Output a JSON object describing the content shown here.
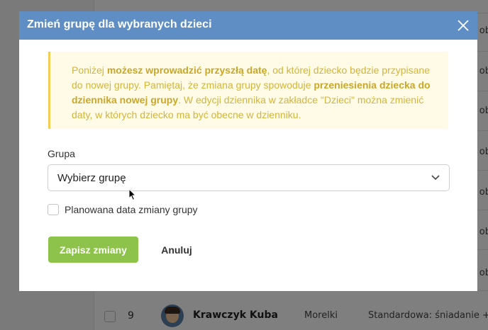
{
  "modal": {
    "title": "Zmień grupę dla wybranych dzieci",
    "notice": {
      "p1": "Poniżej ",
      "b1": "możesz wprowadzić przyszłą datę",
      "p2": ", od której dziecko będzie przypisane do nowej grupy. Pamiętaj, że zmiana grupy spowoduje ",
      "b2": "przeniesienia dziecka do dziennika nowej grupy",
      "p3": ". W edycji dziennika w zakładce \"Dzieci\" można zmienić daty, w których dziecko ma być obecne w dzienniku."
    },
    "group_label": "Grupa",
    "group_select_value": "Wybierz grupę",
    "planned_change_label": "Planowana data zmiany grupy",
    "save_label": "Zapisz zmiany",
    "cancel_label": "Anuluj"
  },
  "background": {
    "ob_texts": [
      "ob",
      "ob",
      "ob",
      "ob",
      "ob",
      "ob",
      "ob",
      "ob"
    ],
    "row": {
      "number": "9",
      "name": "Krawczyk Kuba",
      "group": "Morelki",
      "diet": "Standardowa: śniadanie + ob"
    }
  },
  "colors": {
    "header": "#5e8ec4",
    "notice_bg": "#fffbe6",
    "notice_border": "#f0ce55",
    "notice_text": "#d3b43c",
    "save_button": "#8dc34a"
  },
  "icons": {
    "close": "close-icon",
    "chevron": "chevron-down-icon",
    "cursor": "mouse-pointer-icon"
  }
}
